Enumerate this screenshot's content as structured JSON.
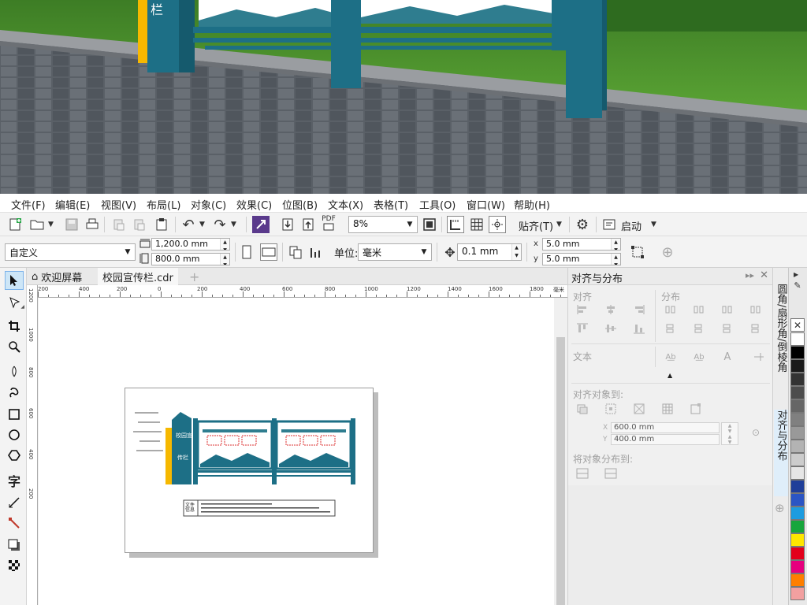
{
  "photo": {
    "sign_text": "栏",
    "colors": {
      "sky": "#3b4a63",
      "grass": "#4e8f2d",
      "teal": "#1d6f86",
      "yellow": "#f6b800",
      "pavement": "#555b61"
    }
  },
  "menu": {
    "items": [
      "文件(F)",
      "编辑(E)",
      "视图(V)",
      "布局(L)",
      "对象(C)",
      "效果(C)",
      "位图(B)",
      "文本(X)",
      "表格(T)",
      "工具(O)",
      "窗口(W)",
      "帮助(H)"
    ]
  },
  "toolbar1": {
    "pdf_label": "PDF",
    "zoom_value": "8%",
    "snap_label": "贴齐(T)",
    "launch_label": "启动",
    "icons": [
      "new-document-icon",
      "open-folder-icon",
      "save-icon",
      "print-icon",
      "import-icon",
      "export-icon",
      "publish-pdf-icon",
      "undo-icon",
      "redo-icon",
      "search-content-icon",
      "full-screen-icon",
      "rulers-icon",
      "grid-icon",
      "guidelines-icon",
      "options-gear-icon",
      "application-launcher-icon"
    ]
  },
  "propbar": {
    "page_size": "自定义",
    "width": "1,200.0 mm",
    "height": "800.0 mm",
    "unit_label": "单位:",
    "unit_value": "毫米",
    "nudge": "0.1 mm",
    "dup_x": "5.0 mm",
    "dup_y": "5.0 mm",
    "dup_x_label": "x",
    "dup_y_label": "y"
  },
  "doctabs": {
    "welcome": "欢迎屏幕",
    "file": "校园宣传栏.cdr",
    "add": "+"
  },
  "ruler": {
    "h_labels": [
      "200",
      "400",
      "200",
      "0",
      "200",
      "400",
      "600",
      "800",
      "1000",
      "1200",
      "1400",
      "1600",
      "1800"
    ],
    "h_unit": "毫米",
    "v_labels": [
      "1200",
      "1000",
      "800",
      "600",
      "400",
      "200"
    ]
  },
  "design": {
    "title_text": "校园宣传栏",
    "stand_strip_text": "弘扬校园文化 共建和谐校园",
    "info_label": "文件信息",
    "colors": {
      "teal": "#1d6f86",
      "yellow": "#f6b800"
    }
  },
  "docker": {
    "title": "对齐与分布",
    "align_label": "对齐",
    "distribute_label": "分布",
    "text_label": "文本",
    "align_to_label": "对齐对象到:",
    "x_label": "X",
    "y_label": "Y",
    "x_value": "600.0 mm",
    "y_value": "400.0 mm",
    "distribute_to_label": "将对象分布到:"
  },
  "sidetabs": {
    "tab1": "圆角/扇形角/倒棱角",
    "tab2": "对齐与分布"
  },
  "palette": {
    "colors": [
      "#ffffff",
      "#000000",
      "#1a1a1a",
      "#333333",
      "#4d4d4d",
      "#666666",
      "#808080",
      "#999999",
      "#b3b3b3",
      "#cccccc",
      "#e6e6e6",
      "#1f3e99",
      "#2b55c4",
      "#1d9ce0",
      "#17a63c",
      "#ffe600",
      "#e3001b",
      "#e6007e",
      "#ff7f00",
      "#f2a0a0"
    ]
  }
}
